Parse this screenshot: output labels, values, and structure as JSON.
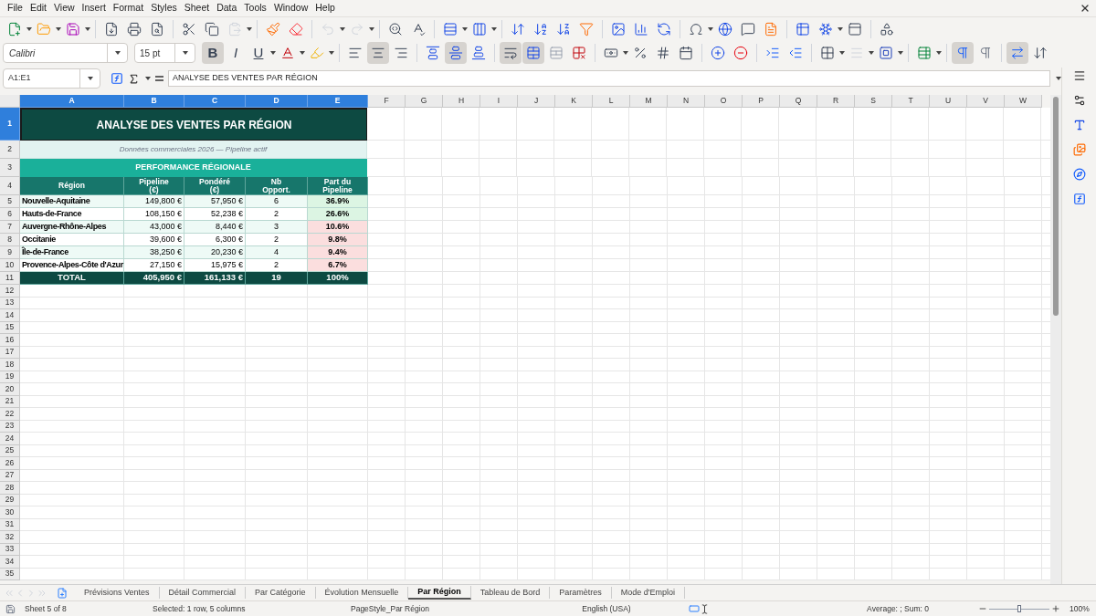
{
  "menu": [
    "File",
    "Edit",
    "View",
    "Insert",
    "Format",
    "Styles",
    "Sheet",
    "Data",
    "Tools",
    "Window",
    "Help"
  ],
  "toolbar_standard": [
    {
      "kind": "new",
      "dropdown": true
    },
    {
      "kind": "open",
      "dropdown": true
    },
    {
      "kind": "save",
      "dropdown": true
    },
    {
      "kind": "separator"
    },
    {
      "kind": "pdf"
    },
    {
      "kind": "print"
    },
    {
      "kind": "preview"
    },
    {
      "kind": "separator"
    },
    {
      "kind": "cut"
    },
    {
      "kind": "copy"
    },
    {
      "kind": "paste",
      "dropdown": true,
      "disabled": true
    },
    {
      "kind": "separator"
    },
    {
      "kind": "clone"
    },
    {
      "kind": "clear"
    },
    {
      "kind": "separator"
    },
    {
      "kind": "undo",
      "dropdown": true,
      "disabled": true
    },
    {
      "kind": "redo",
      "dropdown": true,
      "disabled": true
    },
    {
      "kind": "separator"
    },
    {
      "kind": "find"
    },
    {
      "kind": "spelling"
    },
    {
      "kind": "separator"
    },
    {
      "kind": "rows",
      "dropdown": true
    },
    {
      "kind": "columns",
      "dropdown": true
    },
    {
      "kind": "separator"
    },
    {
      "kind": "sort"
    },
    {
      "kind": "sortasc"
    },
    {
      "kind": "sortdesc"
    },
    {
      "kind": "filter"
    },
    {
      "kind": "separator"
    },
    {
      "kind": "image"
    },
    {
      "kind": "chart"
    },
    {
      "kind": "pivot"
    },
    {
      "kind": "separator"
    },
    {
      "kind": "special",
      "dropdown": true
    },
    {
      "kind": "link"
    },
    {
      "kind": "comment"
    },
    {
      "kind": "headerfooter"
    },
    {
      "kind": "separator"
    },
    {
      "kind": "namedrange"
    },
    {
      "kind": "freeze",
      "dropdown": true
    },
    {
      "kind": "split"
    },
    {
      "kind": "separator"
    },
    {
      "kind": "shapes"
    }
  ],
  "font_name": "Calibri",
  "font_size": "15 pt",
  "toolbar_format": [
    {
      "kind": "text",
      "label": "B",
      "selected": true
    },
    {
      "kind": "text",
      "label": "I",
      "selected": false
    },
    {
      "kind": "text",
      "label": "U",
      "selected": false,
      "dropdown": true
    },
    {
      "kind": "fontcolor",
      "dropdown": true
    },
    {
      "kind": "highlight",
      "dropdown": true
    },
    {
      "kind": "separator"
    },
    {
      "kind": "alignleft",
      "selected": false
    },
    {
      "kind": "aligncenter",
      "selected": true
    },
    {
      "kind": "alignright",
      "selected": false
    },
    {
      "kind": "separator"
    },
    {
      "kind": "aligntop",
      "selected": false
    },
    {
      "kind": "alignmiddle",
      "selected": true
    },
    {
      "kind": "alignbottom",
      "selected": false
    },
    {
      "kind": "separator"
    },
    {
      "kind": "wrap",
      "selected": true
    },
    {
      "kind": "merge",
      "selected": true
    },
    {
      "kind": "unmerge",
      "selected": false
    },
    {
      "kind": "splitcells",
      "selected": false
    },
    {
      "kind": "separator"
    },
    {
      "kind": "currency",
      "dropdown": true
    },
    {
      "kind": "percent"
    },
    {
      "kind": "number"
    },
    {
      "kind": "date"
    },
    {
      "kind": "separator"
    },
    {
      "kind": "adddecimal"
    },
    {
      "kind": "deldecimal"
    },
    {
      "kind": "separator"
    },
    {
      "kind": "indent"
    },
    {
      "kind": "outdent"
    },
    {
      "kind": "separator"
    },
    {
      "kind": "borders",
      "dropdown": true
    },
    {
      "kind": "borderstyle",
      "dropdown": true,
      "disabled": true
    },
    {
      "kind": "bordercolor",
      "dropdown": true
    },
    {
      "kind": "separator"
    },
    {
      "kind": "conditional",
      "dropdown": true
    },
    {
      "kind": "separator"
    },
    {
      "kind": "ltr",
      "selected": true
    },
    {
      "kind": "rtl",
      "selected": false
    },
    {
      "kind": "separator"
    },
    {
      "kind": "stacked",
      "selected": true
    },
    {
      "kind": "direction",
      "selected": false
    }
  ],
  "name_box": "A1:E1",
  "formula": "ANALYSE DES VENTES PAR RÉGION",
  "columns": [
    {
      "label": "A",
      "selected": true
    },
    {
      "label": "B",
      "selected": true
    },
    {
      "label": "C",
      "selected": true
    },
    {
      "label": "D",
      "selected": true
    },
    {
      "label": "E",
      "selected": true
    },
    {
      "label": "F",
      "selected": false
    },
    {
      "label": "G",
      "selected": false
    },
    {
      "label": "H",
      "selected": false
    },
    {
      "label": "I",
      "selected": false
    },
    {
      "label": "J",
      "selected": false
    },
    {
      "label": "K",
      "selected": false
    },
    {
      "label": "L",
      "selected": false
    },
    {
      "label": "M",
      "selected": false
    },
    {
      "label": "N",
      "selected": false
    },
    {
      "label": "O",
      "selected": false
    },
    {
      "label": "P",
      "selected": false
    },
    {
      "label": "Q",
      "selected": false
    },
    {
      "label": "R",
      "selected": false
    },
    {
      "label": "S",
      "selected": false
    },
    {
      "label": "T",
      "selected": false
    },
    {
      "label": "U",
      "selected": false
    },
    {
      "label": "V",
      "selected": false
    },
    {
      "label": "W",
      "selected": false
    }
  ],
  "row_numbers": [
    {
      "label": "1",
      "selected": true
    },
    {
      "label": "2",
      "selected": false
    },
    {
      "label": "3",
      "selected": false
    },
    {
      "label": "4",
      "selected": false
    },
    {
      "label": "5",
      "selected": false
    },
    {
      "label": "6",
      "selected": false
    },
    {
      "label": "7",
      "selected": false
    },
    {
      "label": "8",
      "selected": false
    },
    {
      "label": "9",
      "selected": false
    },
    {
      "label": "10",
      "selected": false
    },
    {
      "label": "11",
      "selected": false
    },
    {
      "label": "12",
      "selected": false
    },
    {
      "label": "13",
      "selected": false
    },
    {
      "label": "14",
      "selected": false
    },
    {
      "label": "15",
      "selected": false
    },
    {
      "label": "16",
      "selected": false
    },
    {
      "label": "17",
      "selected": false
    },
    {
      "label": "18",
      "selected": false
    },
    {
      "label": "19",
      "selected": false
    },
    {
      "label": "20",
      "selected": false
    },
    {
      "label": "21",
      "selected": false
    },
    {
      "label": "22",
      "selected": false
    },
    {
      "label": "23",
      "selected": false
    },
    {
      "label": "24",
      "selected": false
    },
    {
      "label": "25",
      "selected": false
    },
    {
      "label": "26",
      "selected": false
    },
    {
      "label": "27",
      "selected": false
    },
    {
      "label": "28",
      "selected": false
    },
    {
      "label": "29",
      "selected": false
    },
    {
      "label": "30",
      "selected": false
    },
    {
      "label": "31",
      "selected": false
    },
    {
      "label": "32",
      "selected": false
    },
    {
      "label": "33",
      "selected": false
    },
    {
      "label": "34",
      "selected": false
    },
    {
      "label": "35",
      "selected": false
    }
  ],
  "sheet": {
    "title": "ANALYSE DES VENTES PAR RÉGION",
    "subtitle": "Données commerciales 2026 — Pipeline actif",
    "section": "PERFORMANCE RÉGIONALE",
    "headers": [
      "Région",
      "Pipeline (€)",
      "Pondéré (€)",
      "Nb Opport.",
      "Part du Pipeline"
    ],
    "rows": [
      {
        "region": "Nouvelle-Aquitaine",
        "pipeline": "149,800 €",
        "weighted": "57,950 €",
        "count": "6",
        "share": "36.9%",
        "color": "#dcf5e3"
      },
      {
        "region": "Hauts-de-France",
        "pipeline": "108,150 €",
        "weighted": "52,238 €",
        "count": "2",
        "share": "26.6%",
        "color": "#dcf5e3"
      },
      {
        "region": "Auvergne-Rhône-Alpes",
        "pipeline": "43,000 €",
        "weighted": "8,440 €",
        "count": "3",
        "share": "10.6%",
        "color": "#fbdede"
      },
      {
        "region": "Occitanie",
        "pipeline": "39,600 €",
        "weighted": "6,300 €",
        "count": "2",
        "share": "9.8%",
        "color": "#fbdede"
      },
      {
        "region": "Île-de-France",
        "pipeline": "38,250 €",
        "weighted": "20,230 €",
        "count": "4",
        "share": "9.4%",
        "color": "#fbdede"
      },
      {
        "region": "Provence-Alpes-Côte d'Azur",
        "pipeline": "27,150 €",
        "weighted": "15,975 €",
        "count": "2",
        "share": "6.7%",
        "color": "#fbdede"
      }
    ],
    "total": [
      "TOTAL",
      "405,950 €",
      "161,133 €",
      "19",
      "100%"
    ]
  },
  "tabs": [
    {
      "label": "Prévisions Ventes",
      "selected": false
    },
    {
      "label": "Détail Commercial",
      "selected": false
    },
    {
      "label": "Par Catégorie",
      "selected": false
    },
    {
      "label": "Évolution Mensuelle",
      "selected": false
    },
    {
      "label": "Par Région",
      "selected": true
    },
    {
      "label": "Tableau de Bord",
      "selected": false
    },
    {
      "label": "Paramètres",
      "selected": false
    },
    {
      "label": "Mode d'Emploi",
      "selected": false
    }
  ],
  "status": {
    "sheet": "Sheet 5 of 8",
    "selection": "Selected: 1 row, 5 columns",
    "page_style": "PageStyle_Par Région",
    "language": "English (USA)",
    "sum": "Average: ; Sum: 0",
    "zoom": "100%",
    "zoom_level": {
      "level": 0.5
    }
  }
}
